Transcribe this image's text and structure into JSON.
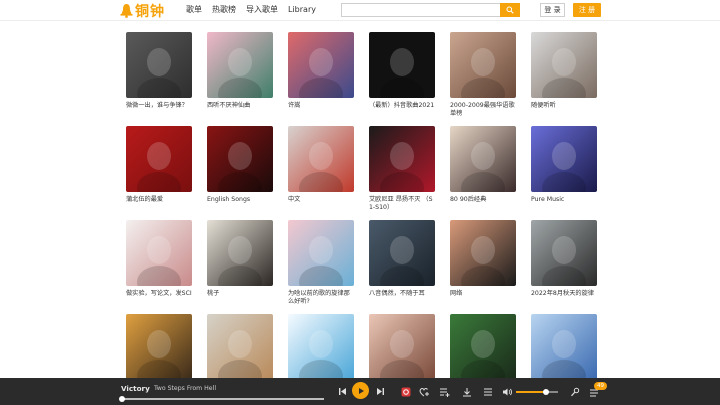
{
  "header": {
    "logo_text": "铜钟",
    "nav": [
      "歌单",
      "热歌榜",
      "导入歌单",
      "Library"
    ],
    "search_placeholder": "",
    "login_label": "登 录",
    "register_label": "注 册"
  },
  "playlists": [
    {
      "title": "微微一出，谁与争锋？",
      "colors": [
        "#5a5a5a",
        "#2e2e2e"
      ]
    },
    {
      "title": "西听不厌神仙曲",
      "colors": [
        "#f0b8c8",
        "#3f7f6a"
      ]
    },
    {
      "title": "许嵩",
      "colors": [
        "#e06a6a",
        "#3b4a8c"
      ]
    },
    {
      "title": "（最新）抖音歌曲2021",
      "colors": [
        "#111111",
        "#111111"
      ]
    },
    {
      "title": "2000-2009最强华语歌单榜",
      "colors": [
        "#caa690",
        "#6b4a3a"
      ]
    },
    {
      "title": "随便听听",
      "colors": [
        "#d9d9d9",
        "#7a6b60"
      ]
    },
    {
      "title": "蒲北伍的最爱",
      "colors": [
        "#b81a1a",
        "#7a0f0f"
      ]
    },
    {
      "title": "English Songs",
      "colors": [
        "#8a1414",
        "#1a0a0a"
      ]
    },
    {
      "title": "中文",
      "colors": [
        "#d8d2cf",
        "#c0392b"
      ]
    },
    {
      "title": "艾欧尼亚 昂扬不灭 （S1-S10）",
      "colors": [
        "#1b1b1b",
        "#b0182a"
      ]
    },
    {
      "title": "80 90后经典",
      "colors": [
        "#e6d6c6",
        "#3a2a2a"
      ]
    },
    {
      "title": "Pure Music",
      "colors": [
        "#6a6ed8",
        "#1a1a4a"
      ]
    },
    {
      "title": "做实验，写论文，发SCI",
      "colors": [
        "#f3f0ef",
        "#c98a8a"
      ]
    },
    {
      "title": "桃子",
      "colors": [
        "#e5e0d6",
        "#2b2622"
      ]
    },
    {
      "title": "为啥以前的歌的旋律那么好听?",
      "colors": [
        "#f3c8cf",
        "#6ab0d6"
      ]
    },
    {
      "title": "八音偶然，不随于耳",
      "colors": [
        "#4a5a6a",
        "#1a222a"
      ]
    },
    {
      "title": "网络",
      "colors": [
        "#d99a7a",
        "#1a1a1a"
      ]
    },
    {
      "title": "2022年8月秋天的旋律",
      "colors": [
        "#a0a6a8",
        "#2a2a2a"
      ]
    },
    {
      "title": "",
      "colors": [
        "#e0a040",
        "#3a2a1a"
      ]
    },
    {
      "title": "",
      "colors": [
        "#d6d2c8",
        "#b98a5a"
      ]
    },
    {
      "title": "",
      "colors": [
        "#f5fbff",
        "#4aa6d8"
      ]
    },
    {
      "title": "",
      "colors": [
        "#eac6b6",
        "#7a4a3a"
      ]
    },
    {
      "title": "",
      "colors": [
        "#3a7a3a",
        "#1a2a1a"
      ]
    },
    {
      "title": "",
      "colors": [
        "#b8d4f0",
        "#3a6ab0"
      ]
    }
  ],
  "player": {
    "title": "Victory",
    "artist": "Two Steps From Hell",
    "progress": 0.0,
    "volume": 0.72,
    "playlist_count": "49"
  }
}
